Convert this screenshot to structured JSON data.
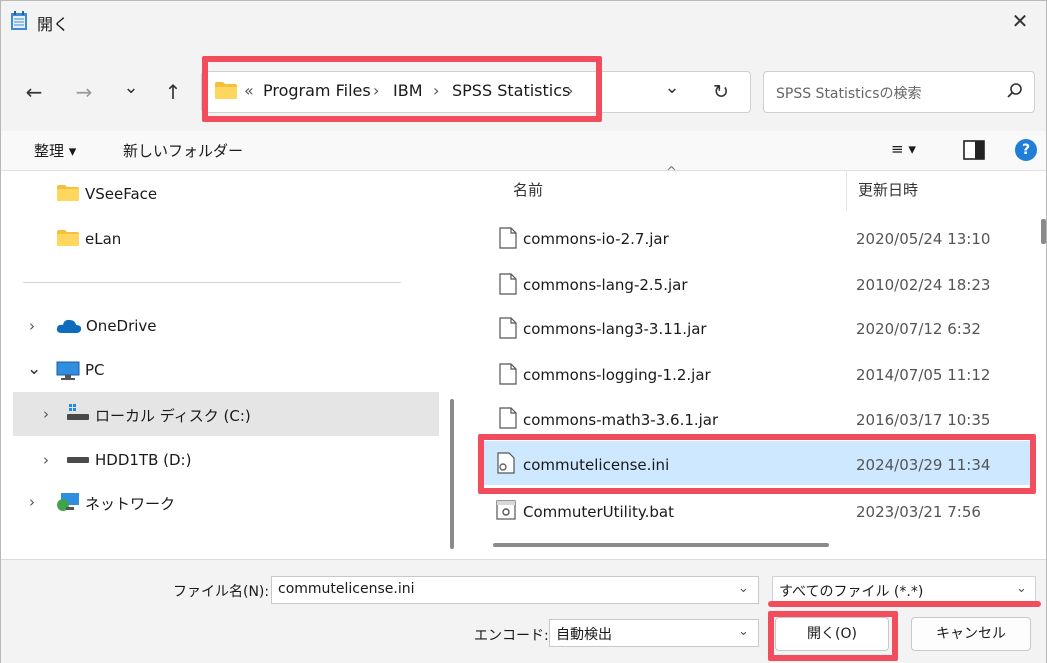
{
  "window": {
    "title": "開く",
    "close_glyph": "✕"
  },
  "nav": {
    "back_glyph": "←",
    "forward_glyph": "→",
    "recent_glyph": "⌄",
    "up_glyph": "↑",
    "overflow": "«",
    "breadcrumbs": [
      "Program Files",
      "IBM",
      "SPSS Statistics"
    ],
    "separator": "›",
    "dropdown_glyph": "⌄",
    "refresh_glyph": "↻"
  },
  "search": {
    "placeholder": "SPSS Statisticsの検索",
    "icon": "search-icon"
  },
  "toolbar": {
    "organize": "整理 ▾",
    "new_folder": "新しいフォルダー",
    "view_glyph": "≡ ▾",
    "help_glyph": "?"
  },
  "tree": {
    "items": [
      {
        "label": "VSeeFace",
        "icon": "folder-icon",
        "expander": ""
      },
      {
        "label": "eLan",
        "icon": "folder-icon",
        "expander": ""
      },
      {
        "label": "OneDrive",
        "icon": "cloud-icon",
        "expander": "›"
      },
      {
        "label": "PC",
        "icon": "pc-icon",
        "expander": "⌄"
      },
      {
        "label": "ローカル ディスク (C:)",
        "icon": "drive-c-icon",
        "expander": "›"
      },
      {
        "label": "HDD1TB (D:)",
        "icon": "drive-icon",
        "expander": "›"
      },
      {
        "label": "ネットワーク",
        "icon": "network-icon",
        "expander": "›"
      }
    ]
  },
  "files": {
    "columns": {
      "name": "名前",
      "date": "更新日時",
      "sort_glyph": "^"
    },
    "rows": [
      {
        "name": "commons-io-2.7.jar",
        "date": "2020/05/24 13:10"
      },
      {
        "name": "commons-lang-2.5.jar",
        "date": "2010/02/24 18:23"
      },
      {
        "name": "commons-lang3-3.11.jar",
        "date": "2020/07/12 6:32"
      },
      {
        "name": "commons-logging-1.2.jar",
        "date": "2014/07/05 11:12"
      },
      {
        "name": "commons-math3-3.6.1.jar",
        "date": "2016/03/17 10:35"
      },
      {
        "name": "commutelicense.ini",
        "date": "2024/03/29 11:34",
        "selected": true
      },
      {
        "name": "CommuterUtility.bat",
        "date": "2023/03/21 7:56"
      }
    ]
  },
  "bottom": {
    "filename_label": "ファイル名(N):",
    "filename_value": "commutelicense.ini",
    "filetype_value": "すべてのファイル (*.*)",
    "encode_label": "エンコード:",
    "encode_value": "自動検出",
    "open_button": "開く(O)",
    "cancel_button": "キャンセル",
    "chevron": "⌄"
  },
  "colors": {
    "highlight": "#f24d5c",
    "selection": "#cde8ff",
    "accent": "#0067c0"
  }
}
